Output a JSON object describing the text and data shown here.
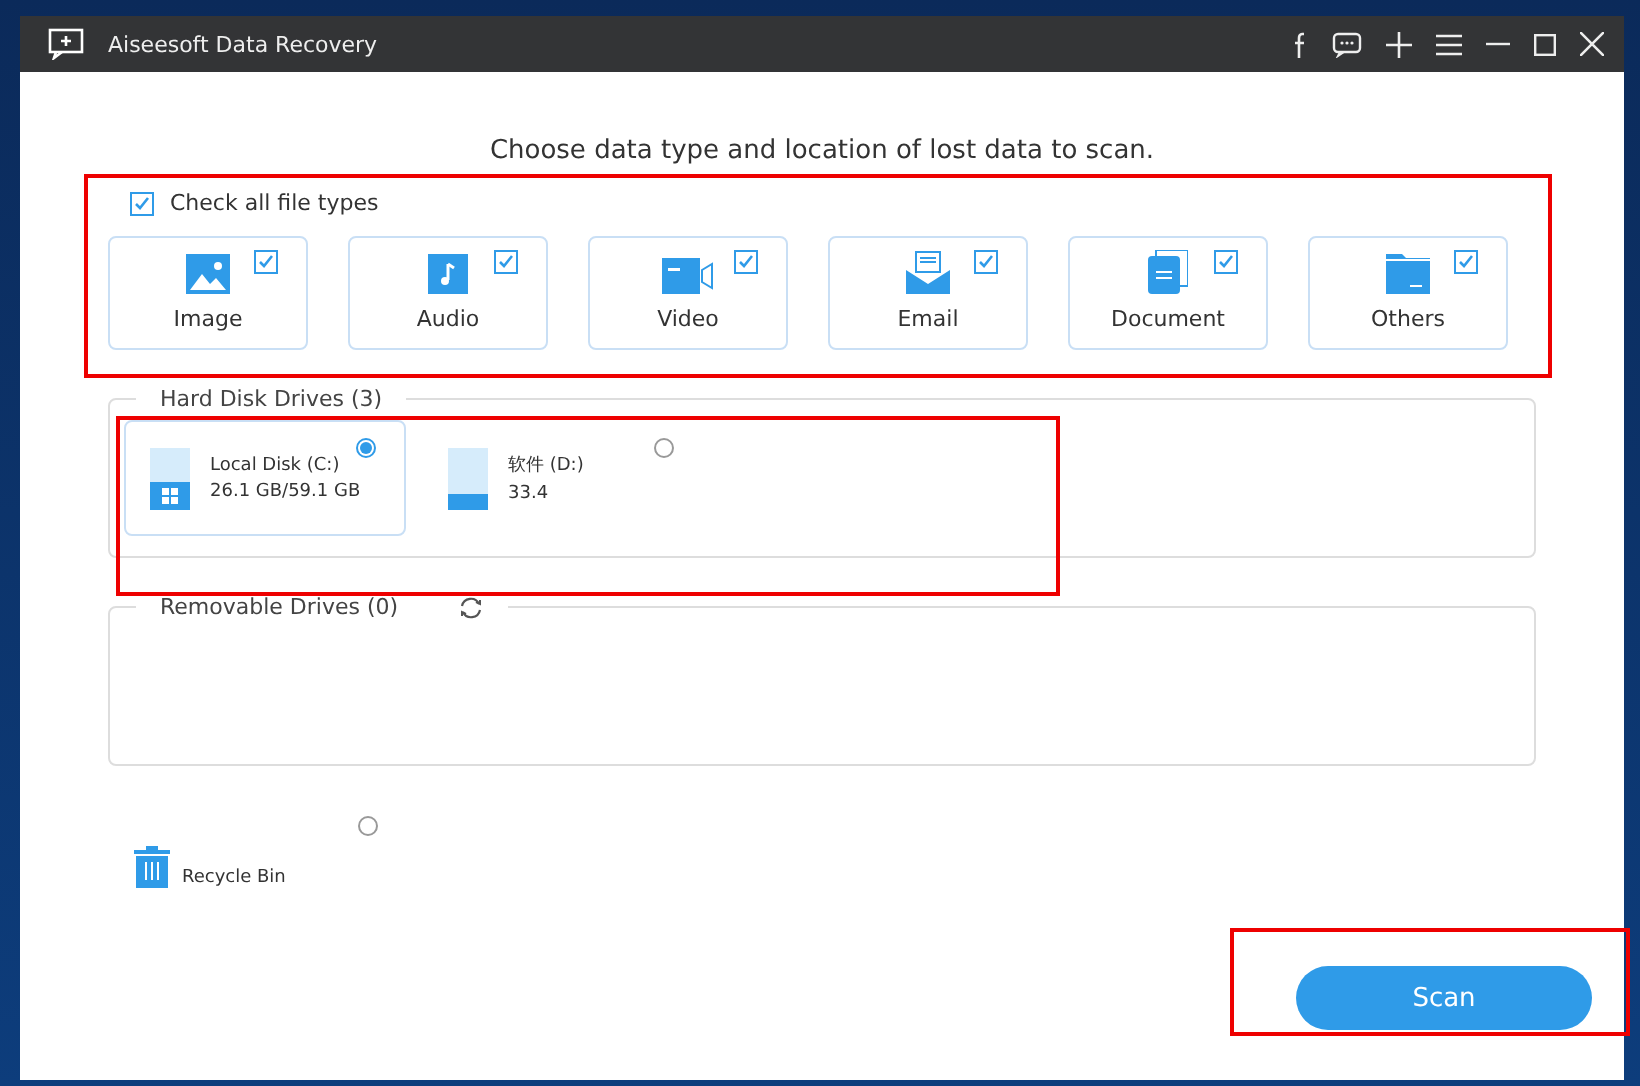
{
  "window": {
    "title": "Aiseesoft Data Recovery"
  },
  "heading": "Choose data type and location of lost data to scan.",
  "check_all": {
    "label": "Check all file types",
    "checked": true
  },
  "file_types": [
    {
      "kind": "image",
      "label": "Image",
      "checked": true
    },
    {
      "kind": "audio",
      "label": "Audio",
      "checked": true
    },
    {
      "kind": "video",
      "label": "Video",
      "checked": true
    },
    {
      "kind": "email",
      "label": "Email",
      "checked": true
    },
    {
      "kind": "document",
      "label": "Document",
      "checked": true
    },
    {
      "kind": "others",
      "label": "Others",
      "checked": true
    }
  ],
  "hard_disk_drives": {
    "label": "Hard Disk Drives (3)",
    "drives": [
      {
        "name": "Local Disk (C:)",
        "size": "26.1 GB/59.1 GB",
        "level": 0.44,
        "selected": true,
        "system": true
      },
      {
        "name": "软件 (D:)",
        "size": "33.4",
        "level": 0.25,
        "selected": false,
        "system": false
      }
    ]
  },
  "removable_drives": {
    "label": "Removable Drives (0)"
  },
  "recycle_bin": {
    "label": "Recycle Bin",
    "selected": false
  },
  "scan_button": "Scan"
}
